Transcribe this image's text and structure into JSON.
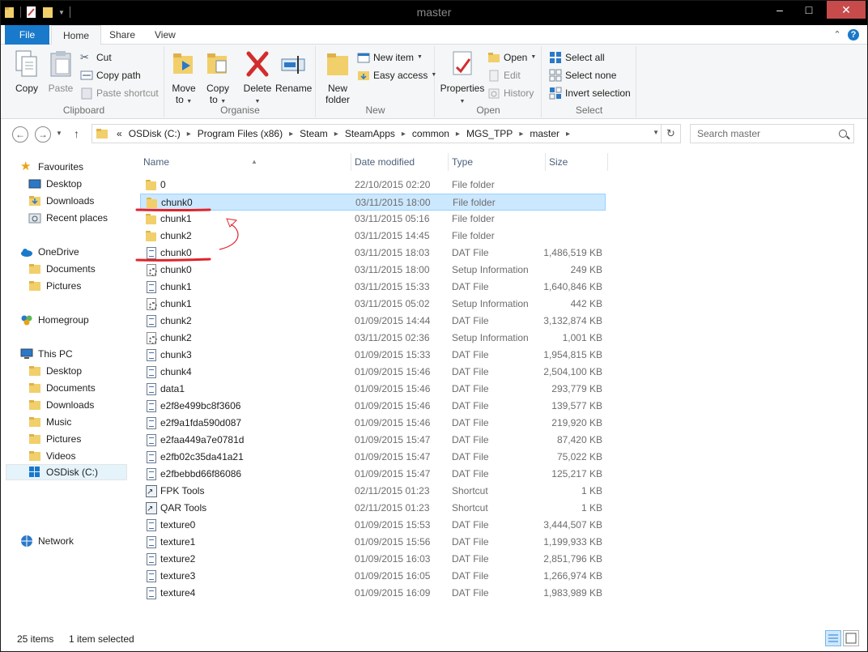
{
  "window": {
    "title": "master"
  },
  "ribbon_tabs": [
    "File",
    "Home",
    "Share",
    "View"
  ],
  "ribbon": {
    "clipboard": {
      "label": "Clipboard",
      "copy": "Copy",
      "paste": "Paste",
      "cut": "Cut",
      "copy_path": "Copy path",
      "paste_shortcut": "Paste shortcut"
    },
    "organise": {
      "label": "Organise",
      "move_to": "Move",
      "move_to2": "to",
      "copy_to": "Copy",
      "copy_to2": "to",
      "delete": "Delete",
      "rename": "Rename"
    },
    "new": {
      "label": "New",
      "new_folder": "New",
      "new_folder2": "folder",
      "new_item": "New item",
      "easy_access": "Easy access"
    },
    "open": {
      "label": "Open",
      "properties": "Properties",
      "open": "Open",
      "edit": "Edit",
      "history": "History"
    },
    "select": {
      "label": "Select",
      "select_all": "Select all",
      "select_none": "Select none",
      "invert": "Invert selection"
    }
  },
  "address": {
    "overflow": "«",
    "crumbs": [
      "OSDisk (C:)",
      "Program Files (x86)",
      "Steam",
      "SteamApps",
      "common",
      "MGS_TPP",
      "master"
    ]
  },
  "search": {
    "placeholder": "Search master"
  },
  "nav": {
    "favourites": "Favourites",
    "fav_items": [
      "Desktop",
      "Downloads",
      "Recent places"
    ],
    "onedrive": "OneDrive",
    "onedrive_items": [
      "Documents",
      "Pictures"
    ],
    "homegroup": "Homegroup",
    "thispc": "This PC",
    "pc_items": [
      "Desktop",
      "Documents",
      "Downloads",
      "Music",
      "Pictures",
      "Videos",
      "OSDisk (C:)"
    ],
    "network": "Network"
  },
  "columns": {
    "name": "Name",
    "date": "Date modified",
    "type": "Type",
    "size": "Size"
  },
  "files": [
    {
      "name": "0",
      "date": "22/10/2015 02:20",
      "type": "File folder",
      "size": "",
      "icon": "folder"
    },
    {
      "name": "chunk0",
      "date": "03/11/2015 18:00",
      "type": "File folder",
      "size": "",
      "icon": "folder",
      "selected": true
    },
    {
      "name": "chunk1",
      "date": "03/11/2015 05:16",
      "type": "File folder",
      "size": "",
      "icon": "folder"
    },
    {
      "name": "chunk2",
      "date": "03/11/2015 14:45",
      "type": "File folder",
      "size": "",
      "icon": "folder"
    },
    {
      "name": "chunk0",
      "date": "03/11/2015 18:03",
      "type": "DAT File",
      "size": "1,486,519 KB",
      "icon": "doc"
    },
    {
      "name": "chunk0",
      "date": "03/11/2015 18:00",
      "type": "Setup Information",
      "size": "249 KB",
      "icon": "gear"
    },
    {
      "name": "chunk1",
      "date": "03/11/2015 15:33",
      "type": "DAT File",
      "size": "1,640,846 KB",
      "icon": "doc"
    },
    {
      "name": "chunk1",
      "date": "03/11/2015 05:02",
      "type": "Setup Information",
      "size": "442 KB",
      "icon": "gear"
    },
    {
      "name": "chunk2",
      "date": "01/09/2015 14:44",
      "type": "DAT File",
      "size": "3,132,874 KB",
      "icon": "doc"
    },
    {
      "name": "chunk2",
      "date": "03/11/2015 02:36",
      "type": "Setup Information",
      "size": "1,001 KB",
      "icon": "gear"
    },
    {
      "name": "chunk3",
      "date": "01/09/2015 15:33",
      "type": "DAT File",
      "size": "1,954,815 KB",
      "icon": "doc"
    },
    {
      "name": "chunk4",
      "date": "01/09/2015 15:46",
      "type": "DAT File",
      "size": "2,504,100 KB",
      "icon": "doc"
    },
    {
      "name": "data1",
      "date": "01/09/2015 15:46",
      "type": "DAT File",
      "size": "293,779 KB",
      "icon": "doc"
    },
    {
      "name": "e2f8e499bc8f3606",
      "date": "01/09/2015 15:46",
      "type": "DAT File",
      "size": "139,577 KB",
      "icon": "doc"
    },
    {
      "name": "e2f9a1fda590d087",
      "date": "01/09/2015 15:46",
      "type": "DAT File",
      "size": "219,920 KB",
      "icon": "doc"
    },
    {
      "name": "e2faa449a7e0781d",
      "date": "01/09/2015 15:47",
      "type": "DAT File",
      "size": "87,420 KB",
      "icon": "doc"
    },
    {
      "name": "e2fb02c35da41a21",
      "date": "01/09/2015 15:47",
      "type": "DAT File",
      "size": "75,022 KB",
      "icon": "doc"
    },
    {
      "name": "e2fbebbd66f86086",
      "date": "01/09/2015 15:47",
      "type": "DAT File",
      "size": "125,217 KB",
      "icon": "doc"
    },
    {
      "name": "FPK Tools",
      "date": "02/11/2015 01:23",
      "type": "Shortcut",
      "size": "1 KB",
      "icon": "shortcut"
    },
    {
      "name": "QAR Tools",
      "date": "02/11/2015 01:23",
      "type": "Shortcut",
      "size": "1 KB",
      "icon": "shortcut"
    },
    {
      "name": "texture0",
      "date": "01/09/2015 15:53",
      "type": "DAT File",
      "size": "3,444,507 KB",
      "icon": "doc"
    },
    {
      "name": "texture1",
      "date": "01/09/2015 15:56",
      "type": "DAT File",
      "size": "1,199,933 KB",
      "icon": "doc"
    },
    {
      "name": "texture2",
      "date": "01/09/2015 16:03",
      "type": "DAT File",
      "size": "2,851,796 KB",
      "icon": "doc"
    },
    {
      "name": "texture3",
      "date": "01/09/2015 16:05",
      "type": "DAT File",
      "size": "1,266,974 KB",
      "icon": "doc"
    },
    {
      "name": "texture4",
      "date": "01/09/2015 16:09",
      "type": "DAT File",
      "size": "1,983,989 KB",
      "icon": "doc"
    }
  ],
  "status": {
    "count": "25 items",
    "selection": "1 item selected"
  },
  "colors": {
    "accent": "#1979ca",
    "selection": "#cce8ff",
    "annotation": "#e0242b"
  }
}
